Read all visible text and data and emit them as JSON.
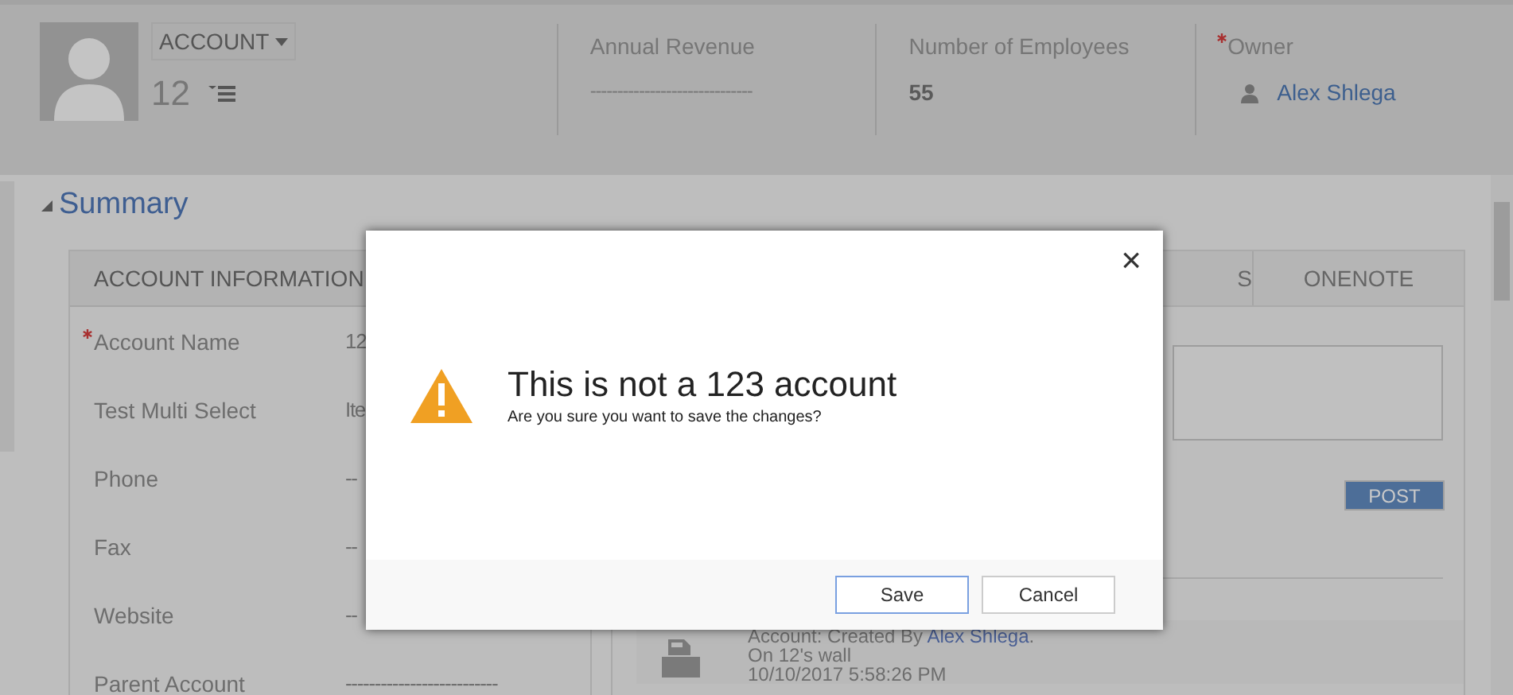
{
  "header": {
    "entity": "ACCOUNT",
    "record_name": "12",
    "fields": [
      {
        "label": "Annual Revenue",
        "value": "------------------------------",
        "kind": "empty",
        "required": false
      },
      {
        "label": "Number of Employees",
        "value": "55",
        "kind": "bold",
        "required": false
      },
      {
        "label": "Owner",
        "value": "Alex Shlega",
        "kind": "lookup",
        "required": true
      }
    ]
  },
  "summary": {
    "title": "Summary",
    "expanded": true,
    "account_information": {
      "title": "ACCOUNT INFORMATION",
      "fields": [
        {
          "label": "Account Name",
          "value": "12",
          "required": true
        },
        {
          "label": "Test Multi Select",
          "value": "Ite",
          "required": false
        },
        {
          "label": "Phone",
          "value": "--",
          "required": false
        },
        {
          "label": "Fax",
          "value": "--",
          "required": false
        },
        {
          "label": "Website",
          "value": "--",
          "required": false
        },
        {
          "label": "Parent Account",
          "value": "--------------------------",
          "required": false
        }
      ]
    },
    "timeline": {
      "tabs": [
        {
          "label": "S"
        },
        {
          "label": "ONENOTE"
        }
      ],
      "post_button": "POST",
      "entry": {
        "prefix": "Account: Created By ",
        "author": "Alex Shlega",
        "suffix": ".",
        "wall": "On 12's wall",
        "date": "10/10/2017 5:58:26 PM"
      }
    }
  },
  "dialog": {
    "title": "This is not a 123 account",
    "message": "Are you sure you want to save the changes?",
    "close": "×",
    "buttons": [
      {
        "label": "Save",
        "primary": true
      },
      {
        "label": "Cancel",
        "primary": false
      }
    ]
  }
}
